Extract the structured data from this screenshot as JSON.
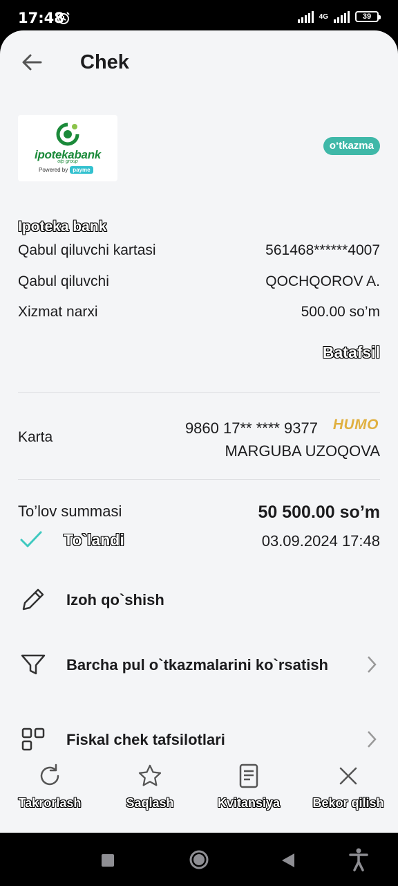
{
  "status_bar": {
    "time": "17:48",
    "network": "4G",
    "battery": "39"
  },
  "header": {
    "title": "Chek"
  },
  "logo": {
    "brand": "ipotekabank",
    "group": "otp group",
    "powered_by": "Powered by",
    "payme": "payme"
  },
  "tag": "o‘tkazma",
  "receipt": {
    "bank_name": "Ipoteka bank",
    "rows": [
      {
        "label": "Qabul qiluvchi kartasi",
        "value": "561468******4007"
      },
      {
        "label": "Qabul qiluvchi",
        "value": "QOCHQOROV A."
      },
      {
        "label": "Xizmat narxi",
        "value": "500.00 so’m"
      }
    ],
    "more_label": "Batafsil"
  },
  "card": {
    "label": "Karta",
    "number": "9860 17** **** 9377",
    "brand": "HUMO",
    "holder": "MARGUBA UZOQOVA"
  },
  "payment": {
    "sum_label": "To’lov summasi",
    "sum_value": "50 500.00 so’m",
    "status": "To`landi",
    "datetime": "03.09.2024 17:48"
  },
  "actions": [
    {
      "label": "Izoh qo`shish",
      "icon": "pencil-icon"
    },
    {
      "label": "Barcha pul o`tkazmalarini ko`rsatish",
      "icon": "filter-icon"
    },
    {
      "label": "Fiskal chek tafsilotlari",
      "icon": "qr-icon"
    }
  ],
  "bottom_bar": [
    {
      "label": "Takrorlash",
      "icon": "repeat-icon"
    },
    {
      "label": "Saqlash",
      "icon": "star-icon"
    },
    {
      "label": "Kvitansiya",
      "icon": "document-icon"
    },
    {
      "label": "Bekor qilish",
      "icon": "close-icon"
    }
  ],
  "colors": {
    "accent": "#3fb8a8",
    "humo": "#e0b040",
    "logo_green": "#1b8a3a",
    "background": "#f4f5f7"
  }
}
